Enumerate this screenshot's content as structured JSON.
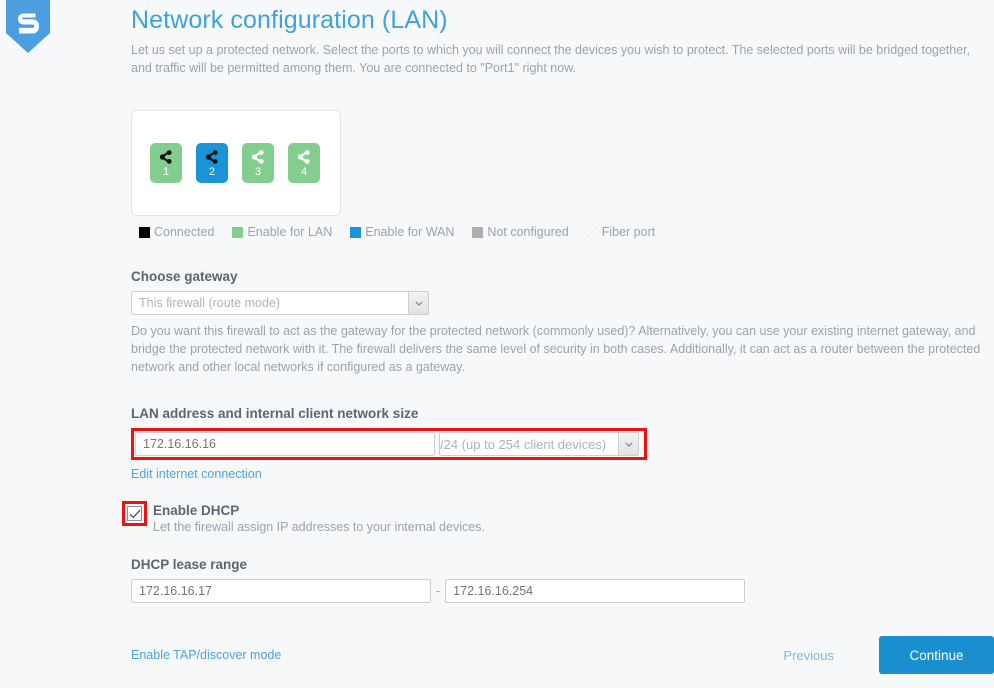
{
  "brand": {
    "logo_icon": "shield-s-logo",
    "logo_letter": "S",
    "accent_color": "#3ea1e0"
  },
  "header": {
    "title": "Network configuration (LAN)",
    "intro": "Let us set up a protected network. Select the ports to which you will connect the devices you wish to protect. The selected ports will be bridged together, and traffic will be permitted among them. You are connected to \"Port1\" right now."
  },
  "ports": {
    "items": [
      {
        "number": "1",
        "state": "Enable for LAN",
        "connected": true,
        "color": "#83ce8e",
        "icon": "network-share-icon"
      },
      {
        "number": "2",
        "state": "Enable for WAN",
        "connected": true,
        "color": "#1a94d6",
        "icon": "network-share-icon"
      },
      {
        "number": "3",
        "state": "Enable for LAN",
        "connected": false,
        "color": "#83ce8e",
        "icon": "network-share-icon"
      },
      {
        "number": "4",
        "state": "Enable for LAN",
        "connected": false,
        "color": "#83ce8e",
        "icon": "network-share-icon"
      }
    ],
    "legend": [
      {
        "label": "Connected",
        "swatch": "#000000"
      },
      {
        "label": "Enable for LAN",
        "swatch": "#83ce8e"
      },
      {
        "label": "Enable for WAN",
        "swatch": "#1a94d6"
      },
      {
        "label": "Not configured",
        "swatch": "#adadad"
      },
      {
        "label": "Fiber port",
        "swatch": "hatched"
      }
    ]
  },
  "gateway": {
    "label": "Choose gateway",
    "selected": "This firewall (route mode)",
    "help": "Do you want this firewall to act as the gateway for the protected network (commonly used)? Alternatively, you can use your existing internet gateway, and bridge the protected network with it. The firewall delivers the same level of security in both cases. Additionally, it can act as a router between the protected network and other local networks if configured as a gateway."
  },
  "lan": {
    "label": "LAN address and internal client network size",
    "ip_value": "172.16.16.16",
    "ip_placeholder": "172.16.16.16",
    "mask_selected": "/24 (up to 254 client devices)",
    "edit_link": "Edit internet connection",
    "highlight_color": "#ee1111"
  },
  "dhcp": {
    "checkbox_checked": true,
    "title": "Enable DHCP",
    "subtitle": "Let the firewall assign IP addresses to your internal devices.",
    "highlight_color": "#ee1111",
    "lease_label": "DHCP lease range",
    "lease_start": "172.16.16.17",
    "lease_start_placeholder": "172.16.16.17",
    "lease_separator": "-",
    "lease_end": "172.16.16.254",
    "lease_end_placeholder": "172.16.16.254"
  },
  "footer": {
    "tap_link": "Enable TAP/discover mode",
    "previous": "Previous",
    "continue": "Continue",
    "continue_color": "#1a8fd0"
  }
}
